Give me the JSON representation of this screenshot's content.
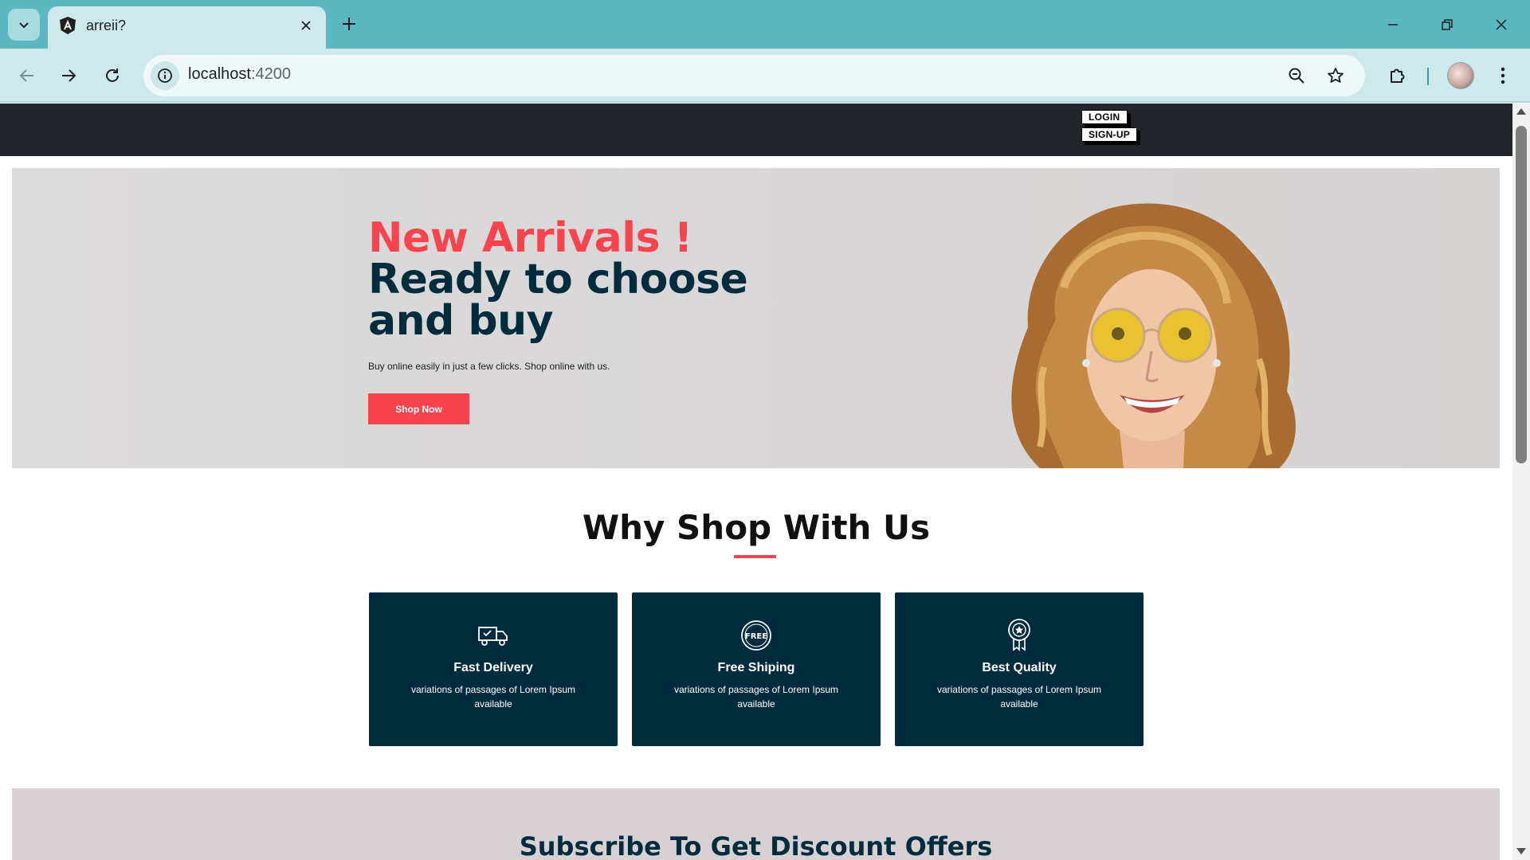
{
  "browser": {
    "tab_title": "arreii?",
    "url_host": "localhost",
    "url_port": ":4200"
  },
  "site": {
    "nav": {
      "login": "LOGIN",
      "signup": "SIGN-UP"
    },
    "hero": {
      "accent": "New Arrivals !",
      "line1": "Ready to choose",
      "line2": "and buy",
      "subtitle": "Buy online easily in just a few clicks. Shop online with us.",
      "cta": "Shop Now"
    },
    "why": {
      "title": "Why Shop With Us",
      "cards": [
        {
          "icon": "delivery-truck-icon",
          "title": "Fast Delivery",
          "text": "variations of passages of Lorem Ipsum available"
        },
        {
          "icon": "free-badge-icon",
          "title": "Free Shiping",
          "text": "variations of passages of Lorem Ipsum available"
        },
        {
          "icon": "quality-award-icon",
          "title": "Best Quality",
          "text": "variations of passages of Lorem Ipsum available"
        }
      ]
    },
    "subscribe": {
      "title": "Subscribe To Get Discount Offers"
    }
  },
  "colors": {
    "accent_red": "#f7444e",
    "navy": "#002c3e",
    "nav_dark": "#212529",
    "chrome_teal": "#5cb8c0"
  }
}
